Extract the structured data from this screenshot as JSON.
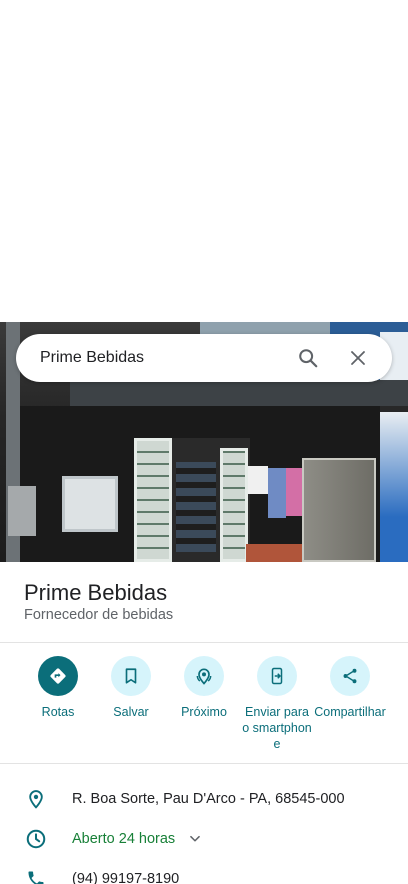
{
  "search": {
    "query": "Prime Bebidas"
  },
  "place": {
    "name": "Prime Bebidas",
    "category": "Fornecedor de bebidas"
  },
  "actions": [
    {
      "label": "Rotas"
    },
    {
      "label": "Salvar"
    },
    {
      "label": "Próximo"
    },
    {
      "label": "Enviar para o smartphone"
    },
    {
      "label": "Compartilhar"
    }
  ],
  "info": {
    "address": "R. Boa Sorte, Pau D'Arco - PA, 68545-000",
    "hours": "Aberto 24 horas",
    "phone": "(94) 99197-8190"
  },
  "colors": {
    "accent": "#0b6e7a",
    "open_green": "#188038",
    "chip_bg": "#d6f4fb"
  },
  "icons": [
    "search-icon",
    "close-icon",
    "directions-icon",
    "bookmark-icon",
    "nearby-icon",
    "send-to-phone-icon",
    "share-icon",
    "location-pin-icon",
    "clock-icon",
    "chevron-down-icon",
    "phone-icon"
  ]
}
